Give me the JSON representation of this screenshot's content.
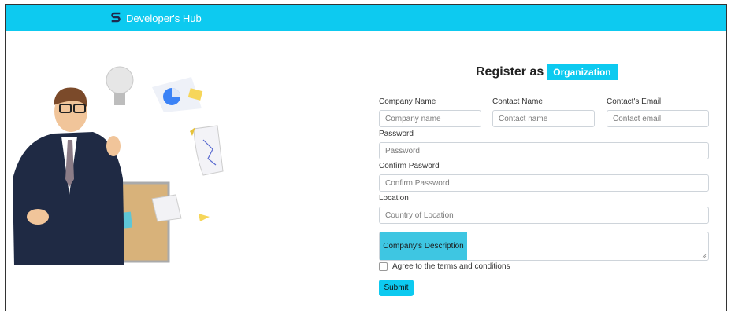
{
  "navbar": {
    "brand": "Developer's Hub",
    "logo_icon": "s-logo-icon"
  },
  "form": {
    "title_prefix": "Register as",
    "title_role": "Organization",
    "fields": {
      "company_name": {
        "label": "Company Name",
        "placeholder": "Company name"
      },
      "contact_name": {
        "label": "Contact Name",
        "placeholder": "Contact name"
      },
      "contact_email": {
        "label": "Contact's Email",
        "placeholder": "Contact email"
      },
      "password": {
        "label": "Password",
        "placeholder": "Password"
      },
      "confirm_password": {
        "label": "Confirm Pasword",
        "placeholder": "Confirm Password"
      },
      "location": {
        "label": "Location",
        "placeholder": "Country of Location"
      },
      "description": {
        "tag": "Company's Description"
      }
    },
    "terms_label": "Agree to the terms and conditions",
    "submit_label": "Submit"
  },
  "colors": {
    "accent": "#0dcaf0",
    "desc_tag": "#3ec6e2"
  }
}
